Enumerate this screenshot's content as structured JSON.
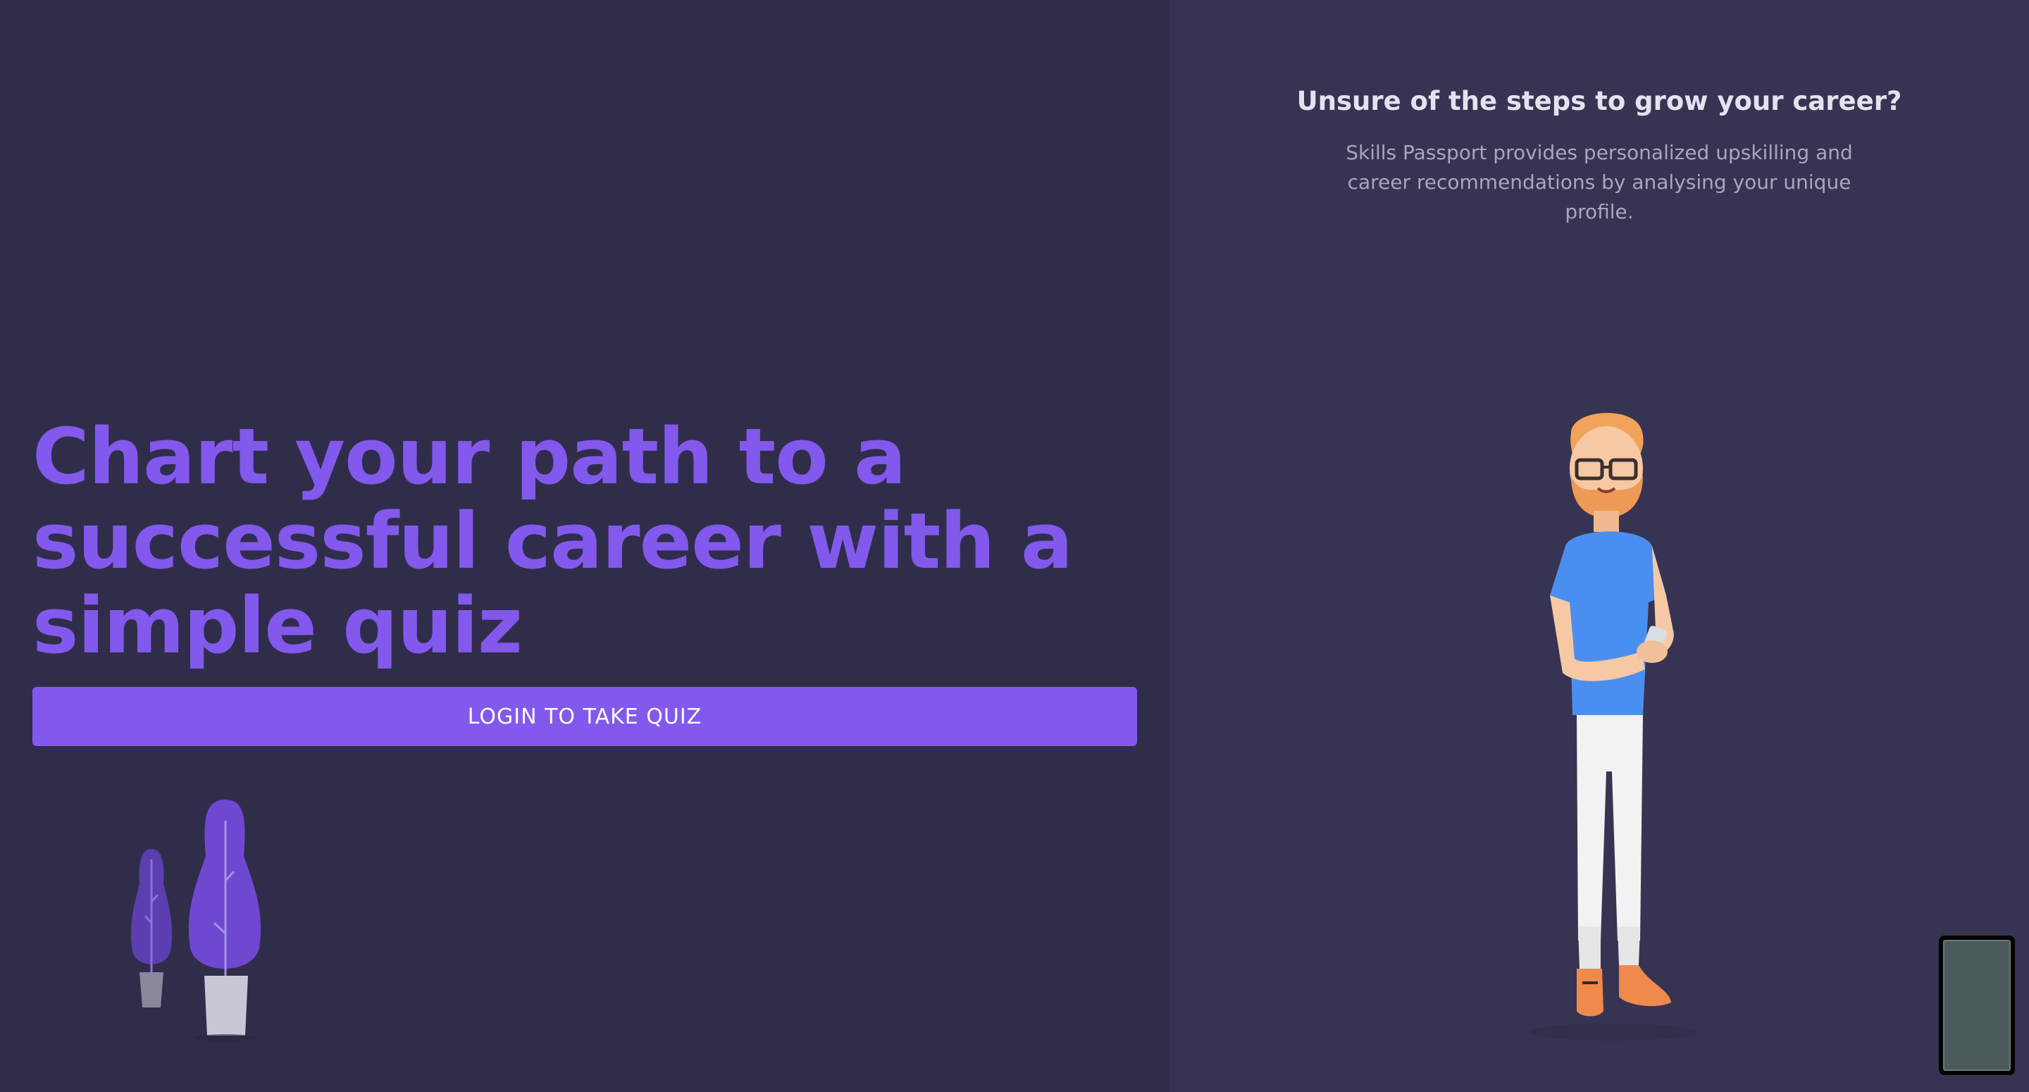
{
  "hero": {
    "headline_line1": "Chart your path to a",
    "headline_line2": "successful career with a",
    "headline_line3": "simple quiz",
    "cta_label": "LOGIN TO TAKE QUIZ"
  },
  "side": {
    "title": "Unsure of the steps to grow your career?",
    "description_line1": "Skills Passport provides personalized upskilling and",
    "description_line2": "career recommendations by analysing your unique",
    "description_line3": "profile."
  },
  "colors": {
    "left_bg": "#302d4b",
    "right_bg": "#373453",
    "accent": "#8259ec"
  },
  "icons": {
    "plants": "potted-plants-illustration",
    "character": "person-with-phone-illustration"
  }
}
